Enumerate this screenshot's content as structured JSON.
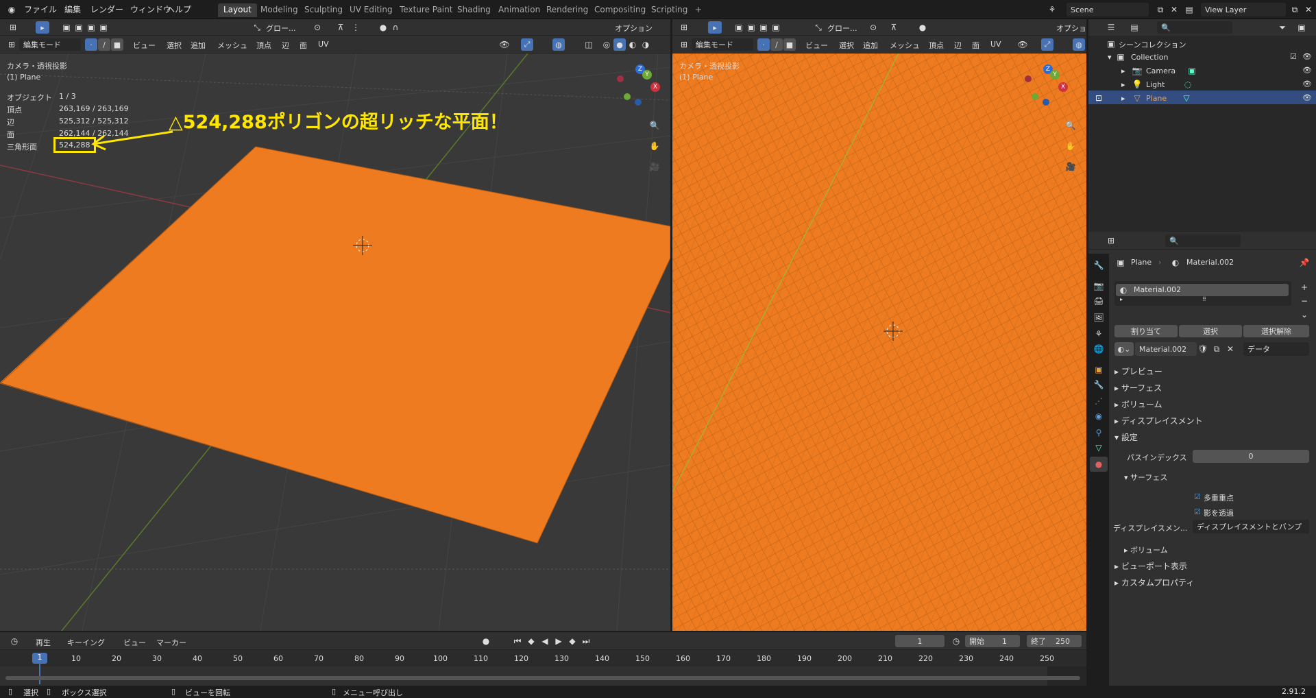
{
  "topbar": {
    "menus": [
      "ファイル",
      "編集",
      "レンダー",
      "ウィンドウ",
      "ヘルプ"
    ],
    "workspaces": [
      "Layout",
      "Modeling",
      "Sculpting",
      "UV Editing",
      "Texture Paint",
      "Shading",
      "Animation",
      "Rendering",
      "Compositing",
      "Scripting"
    ],
    "active_workspace": "Layout",
    "add_tab": "+",
    "scene": "Scene",
    "view_layer": "View Layer"
  },
  "viewport_left": {
    "mode": "編集モード",
    "menus": [
      "ビュー",
      "選択",
      "追加",
      "メッシュ",
      "頂点",
      "辺",
      "面",
      "UV"
    ],
    "transform": "グロー...",
    "options": "オプション",
    "camera_label": "カメラ・透視投影",
    "object_label": "(1) Plane",
    "stats": {
      "objects_label": "オブジェクト",
      "objects_value": "1 / 3",
      "verts_label": "頂点",
      "verts_value": "263,169 / 263,169",
      "edges_label": "辺",
      "edges_value": "525,312 / 525,312",
      "faces_label": "面",
      "faces_value": "262,144 / 262,144",
      "tris_label": "三角形面",
      "tris_value": "524,288"
    },
    "annotation": "△524,288ポリゴンの超リッチな平面！",
    "axis": {
      "x": "X",
      "y": "Y",
      "z": "Z"
    }
  },
  "viewport_right": {
    "mode": "編集モード",
    "menus": [
      "ビュー",
      "選択",
      "追加",
      "メッシュ",
      "頂点",
      "辺",
      "面",
      "UV"
    ],
    "transform": "グロー...",
    "options": "オプショ",
    "camera_label": "カメラ・透視投影",
    "object_label": "(1) Plane",
    "axis": {
      "x": "X",
      "y": "Y",
      "z": "Z"
    },
    "mesh_color": "#ee7b1f"
  },
  "outliner": {
    "scene_collection": "シーンコレクション",
    "collection": "Collection",
    "items": [
      "Camera",
      "Light",
      "Plane"
    ],
    "selected": "Plane"
  },
  "properties": {
    "object": "Plane",
    "material": "Material.002",
    "slot": "Material.002",
    "assign": "割り当て",
    "select": "選択",
    "deselect": "選択解除",
    "material_name": "Material.002",
    "link": "データ",
    "sections": [
      "プレビュー",
      "サーフェス",
      "ボリューム",
      "ディスプレイスメント",
      "設定"
    ],
    "pass_index_label": "パスインデックス",
    "pass_index_value": "0",
    "surface_sub": "サーフェス",
    "multiple_importance": "多重重点",
    "backface": "影を透過",
    "displacement_label": "ディスプレイスメン...",
    "displacement_value": "ディスプレイスメントとバンプ",
    "volume_sub": "ボリューム",
    "viewport_display": "ビューポート表示",
    "custom_props": "カスタムプロパティ"
  },
  "timeline": {
    "menus": [
      "再生",
      "キーイング",
      "ビュー",
      "マーカー"
    ],
    "current_frame": "1",
    "start_label": "開始",
    "start_value": "1",
    "end_label": "終了",
    "end_value": "250",
    "ticks": [
      "1",
      "10",
      "20",
      "30",
      "40",
      "50",
      "60",
      "70",
      "80",
      "90",
      "100",
      "110",
      "120",
      "130",
      "140",
      "150",
      "160",
      "170",
      "180",
      "190",
      "200",
      "210",
      "220",
      "230",
      "240",
      "250"
    ]
  },
  "statusbar": {
    "items": [
      "選択",
      "ボックス選択",
      "ビューを回転",
      "メニュー呼び出し"
    ],
    "version": "2.91.2"
  }
}
